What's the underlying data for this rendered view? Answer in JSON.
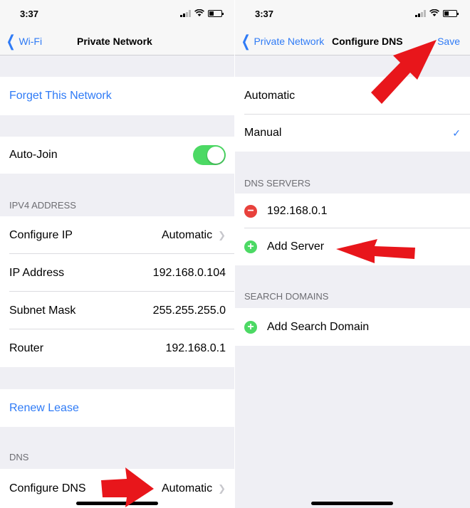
{
  "left": {
    "status": {
      "time": "3:37"
    },
    "nav": {
      "back": "Wi-Fi",
      "title": "Private Network"
    },
    "forget": "Forget This Network",
    "auto_join": {
      "label": "Auto-Join",
      "on": true
    },
    "ipv4": {
      "header": "IPV4 ADDRESS",
      "rows": [
        {
          "label": "Configure IP",
          "value": "Automatic"
        },
        {
          "label": "IP Address",
          "value": "192.168.0.104"
        },
        {
          "label": "Subnet Mask",
          "value": "255.255.255.0"
        },
        {
          "label": "Router",
          "value": "192.168.0.1"
        }
      ]
    },
    "renew": "Renew Lease",
    "dns": {
      "header": "DNS",
      "label": "Configure DNS",
      "value": "Automatic"
    }
  },
  "right": {
    "status": {
      "time": "3:37"
    },
    "nav": {
      "back": "Private Network",
      "title": "Configure DNS",
      "save": "Save"
    },
    "modes": {
      "automatic": "Automatic",
      "manual": "Manual",
      "selected": "Manual"
    },
    "dns_servers": {
      "header": "DNS SERVERS",
      "server": "192.168.0.1",
      "add": "Add Server"
    },
    "search_domains": {
      "header": "SEARCH DOMAINS",
      "add": "Add Search Domain"
    }
  },
  "colors": {
    "accent": "#2f7bf6",
    "toggle_on": "#4cd964",
    "delete": "#e8413c",
    "annotation_arrow": "#e8161b"
  },
  "icons": [
    "back-chevron-icon",
    "signal-icon",
    "wifi-icon",
    "battery-icon",
    "disclosure-chevron-icon",
    "checkmark-icon",
    "delete-circle-icon",
    "add-circle-icon",
    "annotation-arrow"
  ]
}
